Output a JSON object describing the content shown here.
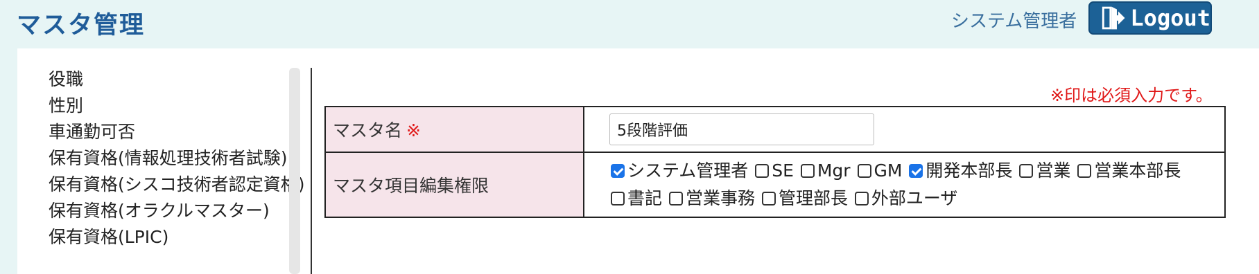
{
  "header": {
    "title": "マスタ管理",
    "user": "システム管理者",
    "logout_label": "Logout"
  },
  "sidebar": {
    "items": [
      {
        "label": "役職"
      },
      {
        "label": "性別"
      },
      {
        "label": "車通勤可否"
      },
      {
        "label": "保有資格(情報処理技術者試験)"
      },
      {
        "label": "保有資格(シスコ技術者認定資格)"
      },
      {
        "label": "保有資格(オラクルマスター)"
      },
      {
        "label": "保有資格(LPIC)"
      }
    ]
  },
  "form": {
    "required_note": "※印は必須入力です。",
    "required_mark": "※",
    "master_name_label": "マスタ名",
    "master_name_value": "5段階評価",
    "permissions_label": "マスタ項目編集権限",
    "permissions": [
      {
        "label": "システム管理者",
        "checked": true
      },
      {
        "label": "SE",
        "checked": false
      },
      {
        "label": "Mgr",
        "checked": false
      },
      {
        "label": "GM",
        "checked": false
      },
      {
        "label": "開発本部長",
        "checked": true
      },
      {
        "label": "営業",
        "checked": false
      },
      {
        "label": "営業本部長",
        "checked": false
      },
      {
        "label": "書記",
        "checked": false
      },
      {
        "label": "営業事務",
        "checked": false
      },
      {
        "label": "管理部長",
        "checked": false
      },
      {
        "label": "外部ユーザ",
        "checked": false
      }
    ]
  },
  "colors": {
    "header_bg": "#e7f5f5",
    "title": "#1f5c99",
    "logout_bg": "#1c6196",
    "label_bg": "#f6e4ea",
    "required": "#e01818",
    "checkbox_checked": "#1a73e8"
  }
}
